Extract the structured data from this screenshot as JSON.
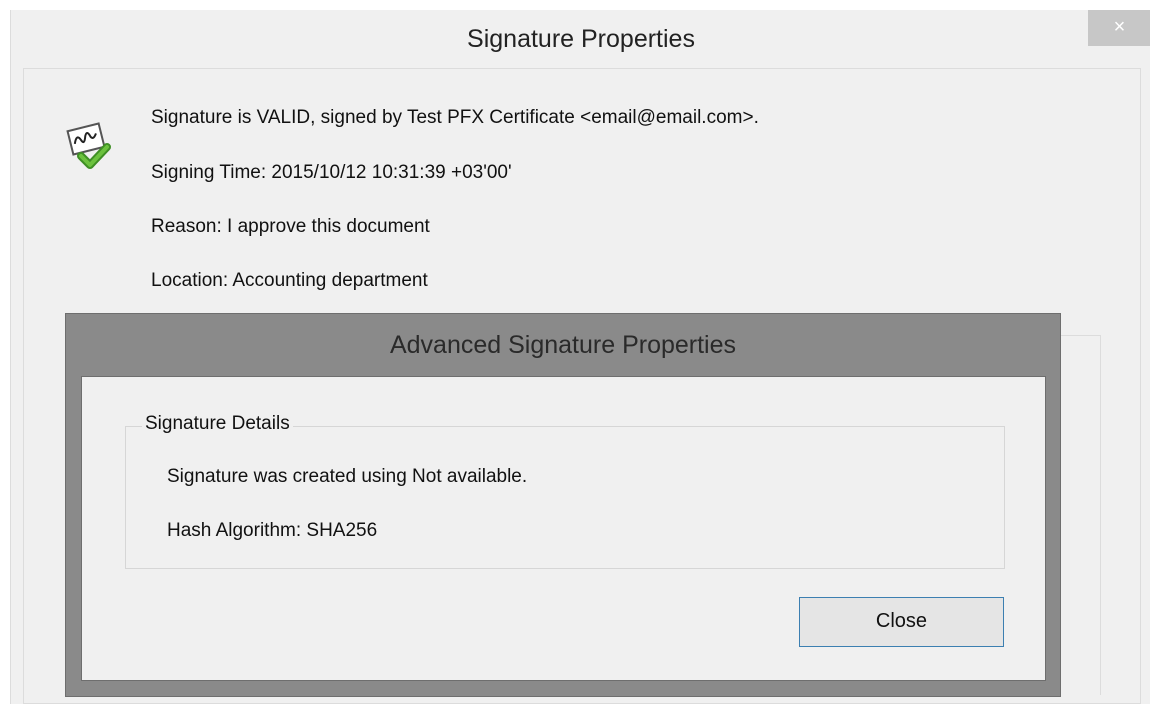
{
  "window": {
    "title": "Signature Properties",
    "close_glyph": "×"
  },
  "signature": {
    "icon": "signature-valid-checkmark-icon",
    "status": "Signature is VALID, signed by Test PFX Certificate <email@email.com>.",
    "signing_time": "Signing Time:  2015/10/12 10:31:39 +03'00'",
    "reason": "Reason:  I approve this document",
    "location": "Location:  Accounting department"
  },
  "advanced": {
    "title": "Advanced Signature Properties",
    "group_label": "Signature Details",
    "created_using": "Signature was created using Not available.",
    "hash_algorithm": "Hash Algorithm: SHA256",
    "close_label": "Close"
  },
  "colors": {
    "outer_background": "#f0f0f0",
    "modal_overlay": "#8a8a8a",
    "button_focus_border": "#3c7fb1",
    "check_green": "#5aa832"
  }
}
